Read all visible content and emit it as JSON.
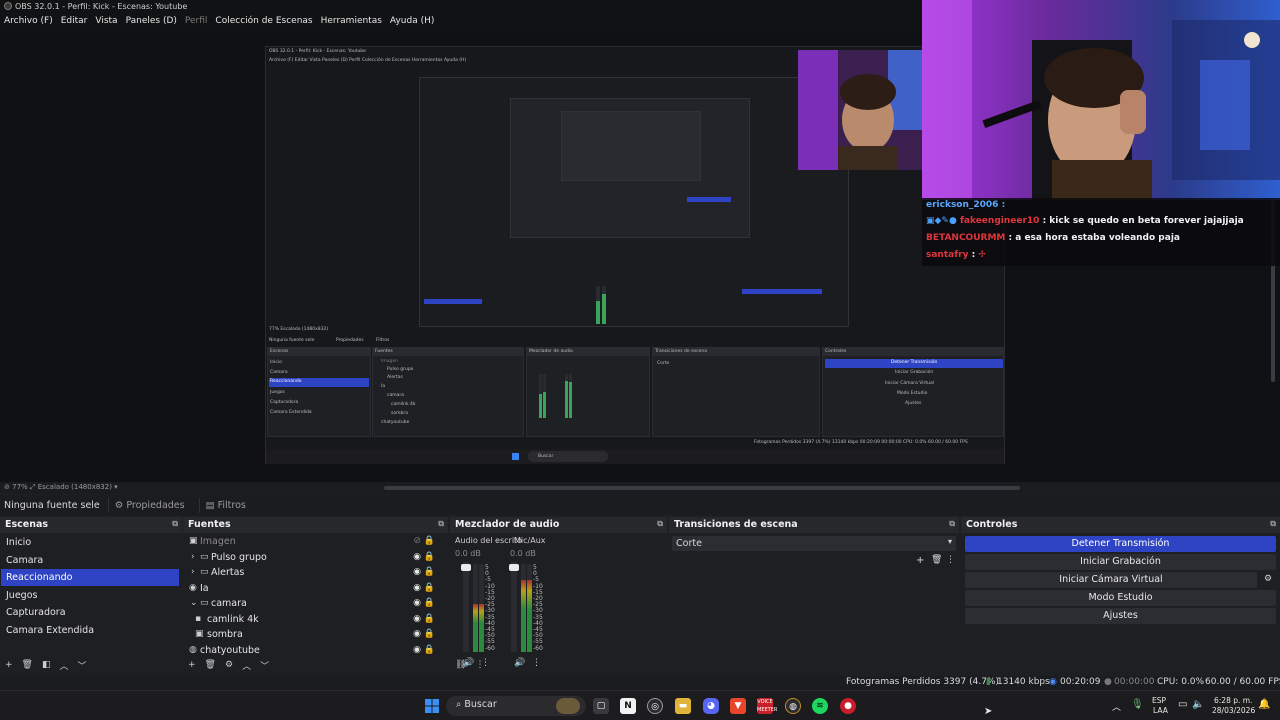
{
  "window": {
    "title": "OBS 32.0.1 - Perfil: Kick - Escenas: Youtube"
  },
  "menu": {
    "items": [
      "Archivo (F)",
      "Editar",
      "Vista",
      "Paneles (D)",
      "Perfil",
      "Colección de Escenas",
      "Herramientas",
      "Ayuda (H)"
    ]
  },
  "nested": {
    "title": "OBS 32.0.1 - Perfil: Kick - Escenas: Youtube",
    "menu": "Archivo (F)   Editar   Vista   Paneles (D)   Perfil   Colección de Escenas   Herramientas   Ayuda (H)",
    "zoom": "77%   Escalado (1480x832)",
    "no_source": "Ninguna fuente sele",
    "props": "Propiedades",
    "filters": "Filtros",
    "scenes_head": "Escenas",
    "sources_head": "Fuentes",
    "mixer_head": "Mezclador de audio",
    "trans_head": "Transiciones de escena",
    "ctrl_head": "Controles",
    "scenes": [
      "Inicio",
      "Camara",
      "Reaccionando",
      "Juegos",
      "Capturadora",
      "Camara Extendida"
    ],
    "sources": [
      "Imagen",
      "Pulso grupo",
      "Alertas",
      "Ia",
      "camara",
      "camlink 4k",
      "sombra",
      "chatyoutube"
    ],
    "cut": "Corte",
    "controls": [
      "Detener Transmisión",
      "Iniciar Grabación",
      "Iniciar Cámara Virtual",
      "Modo Estudio",
      "Ajustes"
    ],
    "status": "Fotogramas Perdidos 3397 (4.7%)     13140 kbps   00:20:09   00:00:00   CPU: 0.0%  60.00 / 60.00 FPS",
    "search": "Buscar",
    "clock": "6:28 p. m.\n28/03/2026"
  },
  "chat": {
    "top_user": "erickson_2006 :",
    "lines": [
      {
        "user": "fakeengineer10",
        "msg": ": kick se quedo en beta forever jajajjaja"
      },
      {
        "user": "BETANCOURMM",
        "msg": ": a esa hora estaba voleando paja"
      },
      {
        "user": "santafry",
        "msg": ":"
      }
    ]
  },
  "scale_bar": {
    "zoom": "77%",
    "scaling": "Escalado (1480x832)"
  },
  "source_bar": {
    "no_source": "Ninguna fuente sele",
    "properties": "Propiedades",
    "filters": "Filtros"
  },
  "scenes": {
    "title": "Escenas",
    "items": [
      "Inicio",
      "Camara",
      "Reaccionando",
      "Juegos",
      "Capturadora",
      "Camara Extendida"
    ],
    "selected": "Reaccionando"
  },
  "sources": {
    "title": "Fuentes",
    "items": [
      {
        "label": "Imagen",
        "type": "image",
        "depth": 0,
        "hidden": true
      },
      {
        "label": "Pulso grupo",
        "type": "folder",
        "depth": 1
      },
      {
        "label": "Alertas",
        "type": "folder",
        "depth": 1
      },
      {
        "label": "Ia",
        "type": "capture",
        "depth": 0
      },
      {
        "label": "camara",
        "type": "folder-open",
        "depth": 1
      },
      {
        "label": "camlink 4k",
        "type": "camera",
        "depth": 2
      },
      {
        "label": "sombra",
        "type": "image",
        "depth": 2
      },
      {
        "label": "chatyoutube",
        "type": "browser",
        "depth": 0
      }
    ]
  },
  "mixer": {
    "title": "Mezclador de audio",
    "channels": [
      {
        "name": "Audio del escrito",
        "db": "0.0 dB",
        "level": 0.55
      },
      {
        "name": "Mic/Aux",
        "db": "0.0 dB",
        "level": 0.82
      }
    ],
    "scale": [
      "5",
      "0",
      "-5",
      "-10",
      "-15",
      "-20",
      "-25",
      "-30",
      "-35",
      "-40",
      "-45",
      "-50",
      "-55",
      "-60"
    ]
  },
  "transitions": {
    "title": "Transiciones de escena",
    "current": "Corte"
  },
  "controls": {
    "title": "Controles",
    "buttons": [
      "Detener Transmisión",
      "Iniciar Grabación",
      "Iniciar Cámara Virtual",
      "Modo Estudio",
      "Ajustes"
    ]
  },
  "status": {
    "dropped": "Fotogramas Perdidos 3397 (4.7%)",
    "bitrate": "13140 kbps",
    "stream_time": "00:20:09",
    "rec_time": "00:00:00",
    "cpu": "CPU: 0.0%",
    "fps": "60.00 / 60.00 FPS"
  },
  "taskbar": {
    "search": "Buscar",
    "lang": "ESP",
    "layout": "LAA",
    "time": "6:28 p. m.",
    "date": "28/03/2026"
  },
  "colors": {
    "accent": "#2e44c4",
    "bg": "#1e1f22",
    "chat_user": "#e0363b"
  }
}
